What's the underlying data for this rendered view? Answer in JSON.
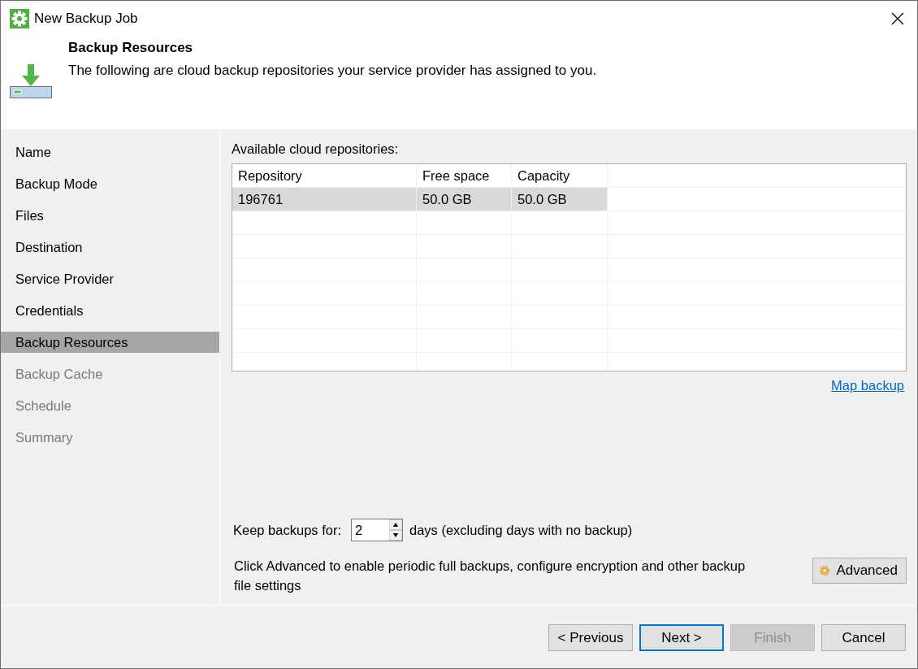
{
  "window": {
    "title": "New Backup Job"
  },
  "header": {
    "title": "Backup Resources",
    "description": "The following are cloud backup repositories your service provider has assigned to you."
  },
  "steps": [
    {
      "label": "Name",
      "selected": false,
      "disabled": false
    },
    {
      "label": "Backup Mode",
      "selected": false,
      "disabled": false
    },
    {
      "label": "Files",
      "selected": false,
      "disabled": false
    },
    {
      "label": "Destination",
      "selected": false,
      "disabled": false
    },
    {
      "label": "Service Provider",
      "selected": false,
      "disabled": false
    },
    {
      "label": "Credentials",
      "selected": false,
      "disabled": false
    },
    {
      "label": "Backup Resources",
      "selected": true,
      "disabled": false
    },
    {
      "label": "Backup Cache",
      "selected": false,
      "disabled": true
    },
    {
      "label": "Schedule",
      "selected": false,
      "disabled": true
    },
    {
      "label": "Summary",
      "selected": false,
      "disabled": true
    }
  ],
  "repositories": {
    "label": "Available cloud repositories:",
    "columns": [
      "Repository",
      "Free space",
      "Capacity"
    ],
    "rows": [
      {
        "cells": [
          "196761",
          "50.0 GB",
          "50.0 GB"
        ],
        "selected": true
      }
    ],
    "link": "Map backup"
  },
  "retention": {
    "label": "Keep backups for:",
    "value": "2",
    "suffix": "days (excluding days with no backup)"
  },
  "advanced": {
    "text": "Click Advanced to enable periodic full backups, configure encryption and other backup file settings",
    "button": "Advanced"
  },
  "buttons": [
    {
      "label": "< Previous",
      "disabled": false,
      "default": false
    },
    {
      "label": "Next >",
      "disabled": false,
      "default": true
    },
    {
      "label": "Finish",
      "disabled": true,
      "default": false
    },
    {
      "label": "Cancel",
      "disabled": false,
      "default": false
    }
  ]
}
